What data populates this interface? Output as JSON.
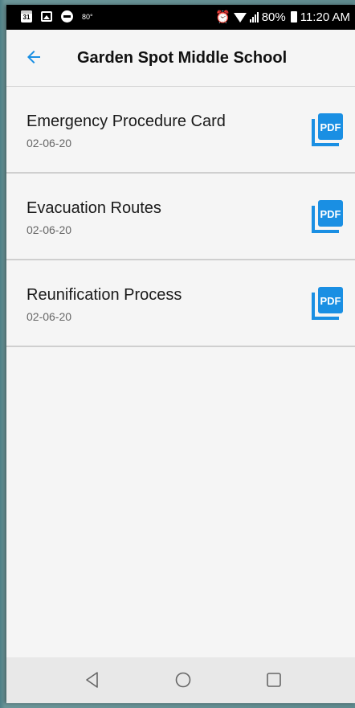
{
  "status_bar": {
    "calendar_day": "31",
    "temperature": "80°",
    "battery_percent": "80%",
    "time": "11:20 AM",
    "icons": [
      "calendar-icon",
      "image-icon",
      "do-not-disturb-icon",
      "alarm-icon",
      "wifi-icon",
      "signal-icon",
      "battery-icon"
    ]
  },
  "app_bar": {
    "title": "Garden Spot Middle School",
    "back_icon": "arrow-left-icon",
    "accent_color": "#1a8fe3"
  },
  "documents": [
    {
      "title": "Emergency Procedure Card",
      "date": "02-06-20",
      "badge": "PDF"
    },
    {
      "title": "Evacuation Routes",
      "date": "02-06-20",
      "badge": "PDF"
    },
    {
      "title": "Reunification Process",
      "date": "02-06-20",
      "badge": "PDF"
    }
  ],
  "nav_bar": {
    "icons": [
      "back-triangle-icon",
      "home-circle-icon",
      "recents-square-icon"
    ]
  }
}
